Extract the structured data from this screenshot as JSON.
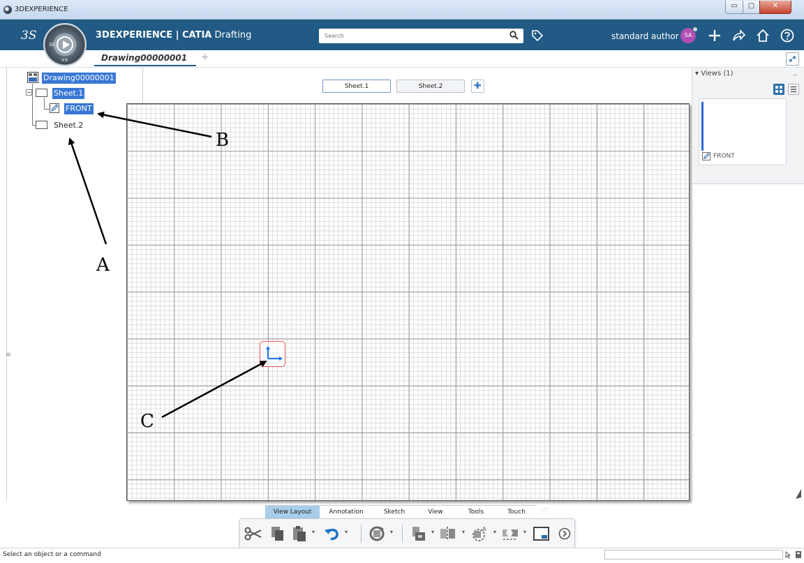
{
  "window": {
    "title": "3DEXPERIENCE",
    "minimize_glyph": "▭",
    "maximize_glyph": "▢",
    "close_glyph": "✕"
  },
  "header": {
    "brand_prefix": "3DEXPERIENCE | ",
    "brand_app": "CATIA",
    "brand_suffix": " Drafting",
    "search_placeholder": "Search",
    "user_name": "standard author",
    "avatar_initials": "SA",
    "compass_version": "V.6",
    "compass_3d": "3D"
  },
  "doc_tabs": {
    "active": "Drawing00000001",
    "add_glyph": "+"
  },
  "tree": {
    "root": "Drawing00000001",
    "sheet1": "Sheet.1",
    "view_front": "FRONT",
    "sheet2": "Sheet.2"
  },
  "sheet_tabs": [
    "Sheet.1",
    "Sheet.2"
  ],
  "views_panel": {
    "title": "Views (1)",
    "collapse_glyph": "▾",
    "minimize_glyph": "_",
    "view_name": "FRONT"
  },
  "action_bar": {
    "sections": [
      "View Layout",
      "Annotation",
      "Sketch",
      "View",
      "Tools",
      "Touch"
    ],
    "more_glyph": "♡",
    "dropdown_glyph": "▾"
  },
  "status": {
    "message": "Select an object or a command"
  },
  "annotations": {
    "a": "A",
    "b": "B",
    "c": "C"
  },
  "left_chevron": "«",
  "colors": {
    "header": "#215a84",
    "selection": "#3878d4",
    "active_section": "#a7cde8",
    "axis": "#1a73e8"
  }
}
